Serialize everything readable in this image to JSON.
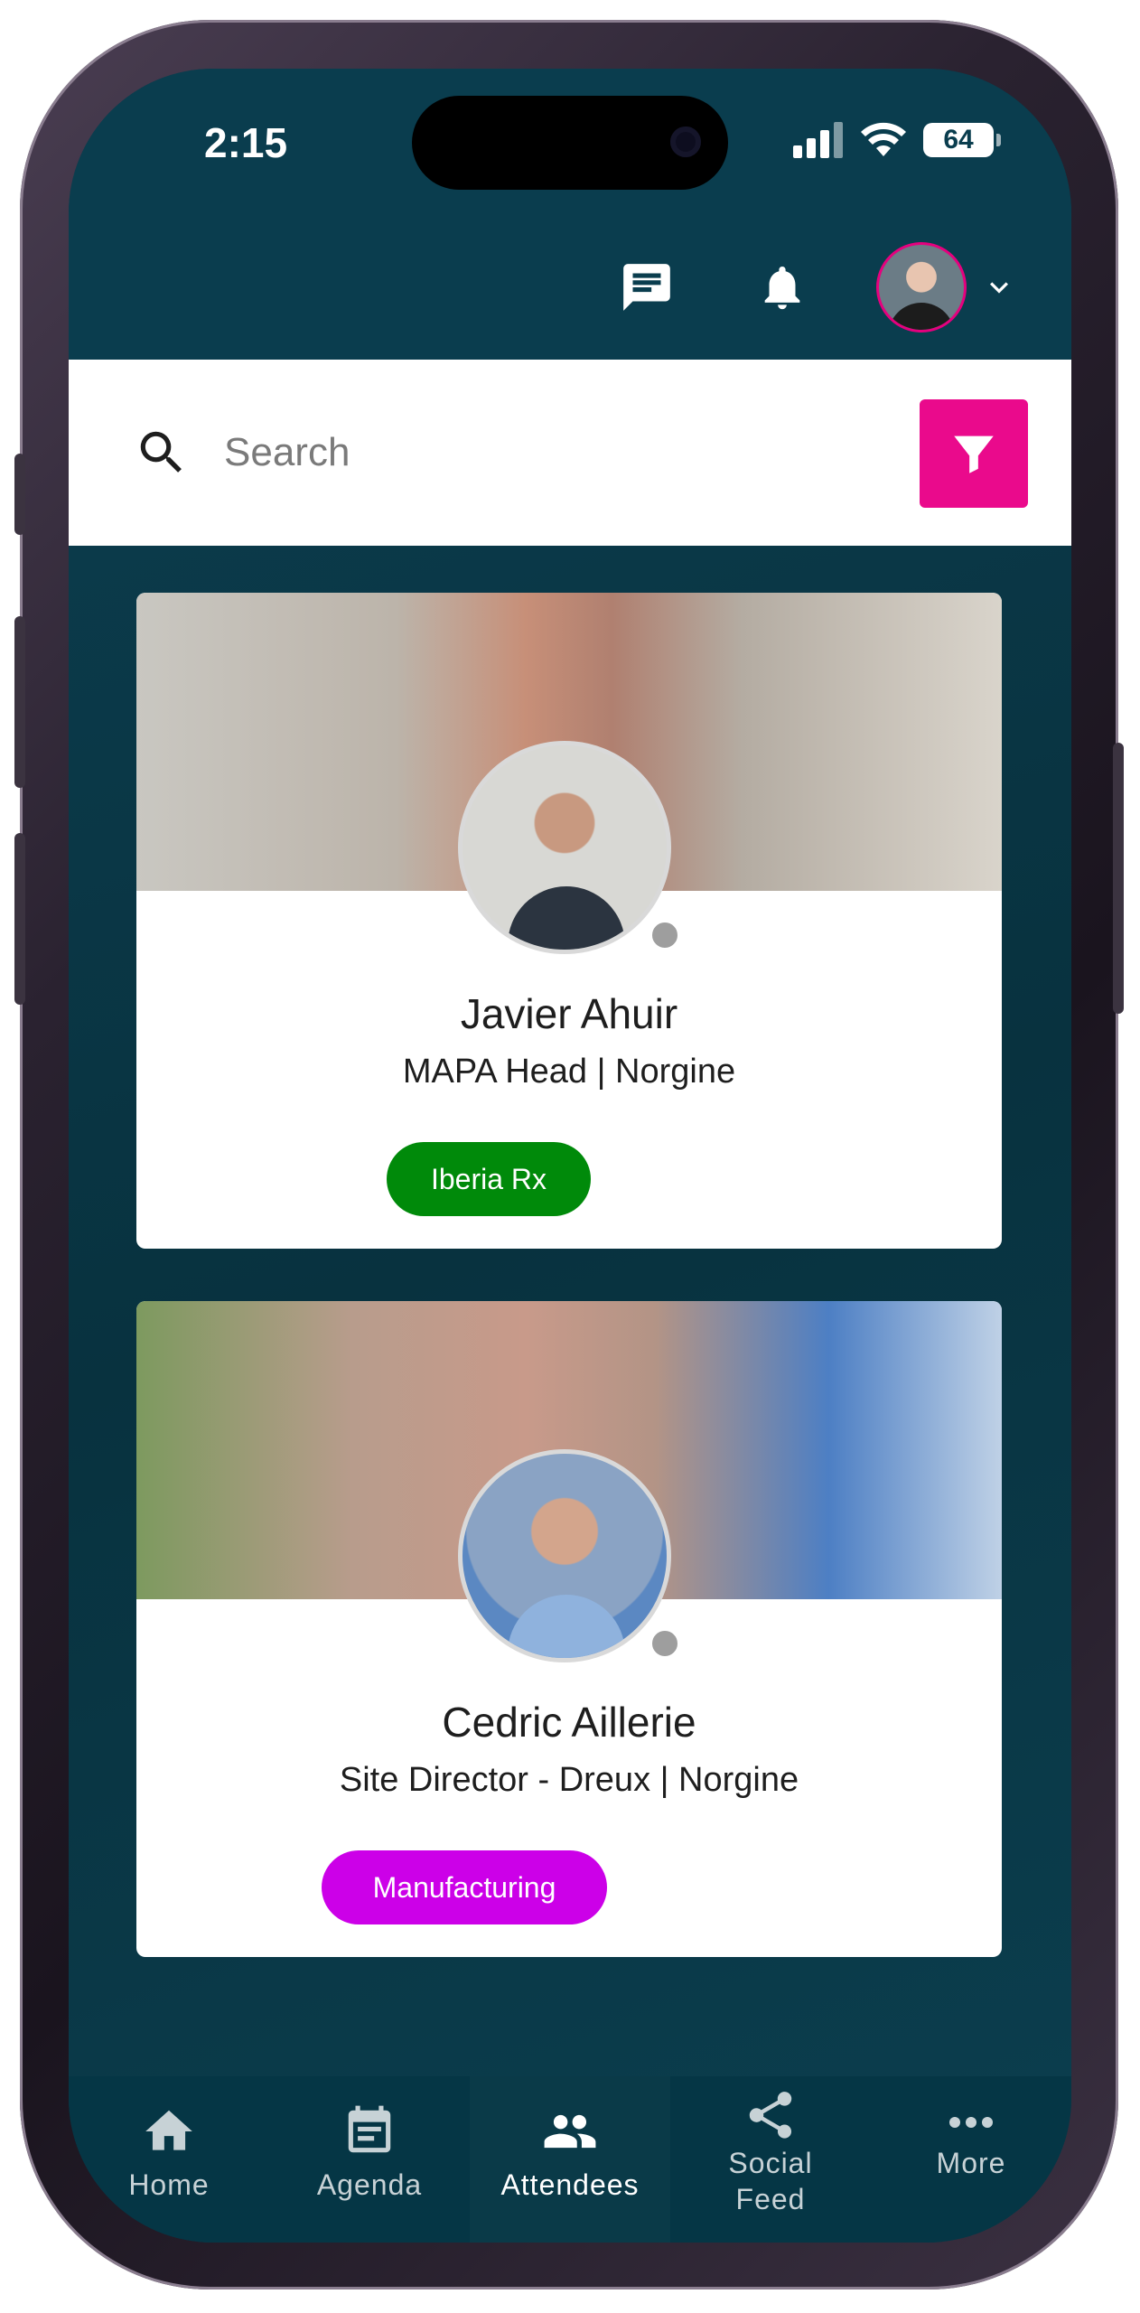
{
  "status_bar": {
    "time": "2:15",
    "battery": "64"
  },
  "header": {
    "icons": [
      "chat-icon",
      "bell-icon",
      "avatar",
      "chevron-down-icon"
    ]
  },
  "search": {
    "placeholder": "Search",
    "value": "",
    "filter_color": "#ea0a8c"
  },
  "attendees": [
    {
      "name": "Javier Ahuir",
      "title": "MAPA Head | Norgine",
      "tag": "Iberia Rx",
      "tag_color": "#008a0a"
    },
    {
      "name": "Cedric Aillerie",
      "title": "Site Director - Dreux | Norgine",
      "tag": "Manufacturing",
      "tag_color": "#cc00e8"
    }
  ],
  "bottom_nav": {
    "items": [
      {
        "label": "Home",
        "icon": "home-icon"
      },
      {
        "label": "Agenda",
        "icon": "calendar-icon"
      },
      {
        "label": "Attendees",
        "icon": "people-icon",
        "active": true
      },
      {
        "label": "Social\nFeed",
        "icon": "share-icon"
      },
      {
        "label": "More",
        "icon": "more-icon"
      }
    ]
  },
  "theme": {
    "background": "#0a3d4e",
    "accent": "#ea0a8c"
  }
}
